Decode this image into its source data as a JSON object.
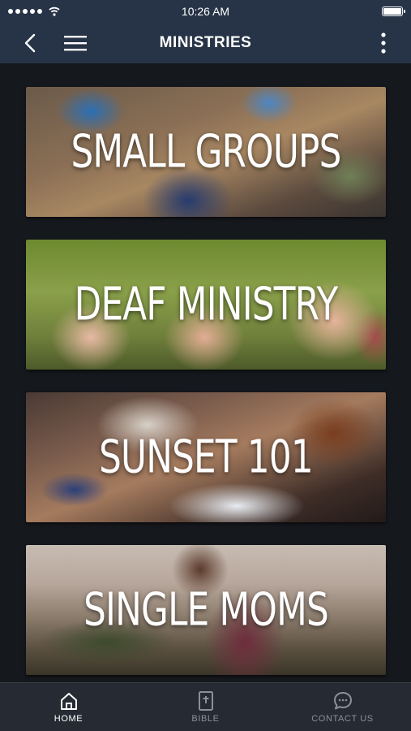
{
  "status_bar": {
    "time": "10:26 AM",
    "signal_dots": 5,
    "icons": [
      "signal-dots-icon",
      "wifi-icon",
      "battery-icon"
    ]
  },
  "nav": {
    "title": "MINISTRIES",
    "icons": [
      "back-arrow-icon",
      "hamburger-menu-icon",
      "more-vertical-icon"
    ]
  },
  "tiles": [
    {
      "label": "SMALL GROUPS"
    },
    {
      "label": "DEAF MINISTRY"
    },
    {
      "label": "SUNSET 101"
    },
    {
      "label": "SINGLE MOMS"
    }
  ],
  "tab_bar": {
    "active_index": 0,
    "tabs": [
      {
        "label": "HOME",
        "icon": "home-icon"
      },
      {
        "label": "BIBLE",
        "icon": "bible-icon"
      },
      {
        "label": "CONTACT US",
        "icon": "chat-bubble-icon"
      }
    ]
  },
  "colors": {
    "bar_background": "#273447",
    "content_background": "#15181d",
    "tab_bar_background": "#262b33",
    "inactive_tab": "#8a9099",
    "active_tab": "#ffffff"
  }
}
